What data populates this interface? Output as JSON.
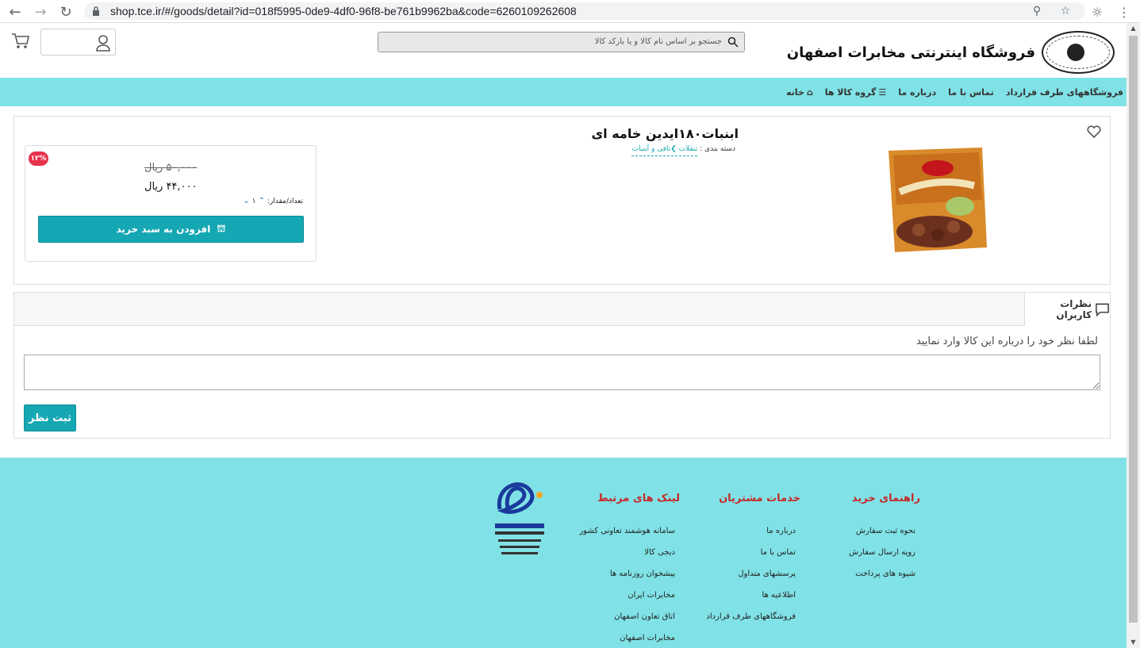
{
  "browser": {
    "url": "shop.tce.ir/#/goods/detail?id=018f5995-0de9-4df0-96f8-be761b9962ba&code=6260109262608"
  },
  "header": {
    "site_title": "فروشگاه اینترنتی مخابرات اصفهان",
    "search_placeholder": "جستجو بر اساس نام کالا و یا بارکد کالا"
  },
  "nav": {
    "items": [
      "خانه",
      "گروه کالا ها",
      "درباره ما",
      "تماس با ما",
      "فروشگاههای طرف قرارداد"
    ]
  },
  "product": {
    "title": "ابنبات۱۸۰ایدین خامه ای",
    "category_label": "دسته بندی :",
    "category_path": "تنقلات ❯تافی و آبنبات",
    "discount_badge": "۱۲%",
    "old_price": "۵۰,۰۰۰ ریال",
    "new_price": "۴۴,۰۰۰ ریال",
    "qty_label": "تعداد/مقدار:",
    "qty_value": "۱",
    "add_to_cart": "افزودن به سبد خرید"
  },
  "comments": {
    "tab_label": "نظرات کاربران",
    "prompt": "لطفا نظر خود را درباره این کالا وارد نمایید",
    "submit": "ثبت نظر"
  },
  "footer": {
    "col1": {
      "title": "راهنمای خرید",
      "links": [
        "نحوه ثبت سفارش",
        "رویه ارسال سفارش",
        "شیوه های پرداخت"
      ]
    },
    "col2": {
      "title": "خدمات مشتریان",
      "links": [
        "درباره ما",
        "تماس با ما",
        "پرسشهای متداول",
        "اطلاعیه ها",
        "فروشگاههای طرف قرارداد"
      ]
    },
    "col3": {
      "title": "لینک های مرتبط",
      "links": [
        "سامانه هوشمند تعاونی کشور",
        "دیجی کالا",
        "پیشخوان روزنامه ها",
        "مخابرات ایران",
        "اتاق تعاون اصفهان",
        "مخابرات اصفهان"
      ]
    }
  },
  "colors": {
    "accent": "#80e2e6",
    "button": "#15a7b3",
    "badge": "#e8314c",
    "footer_title": "#c62828"
  }
}
